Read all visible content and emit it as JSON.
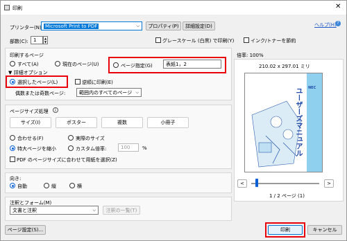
{
  "window": {
    "title": "印刷"
  },
  "printer": {
    "label": "プリンター(N):",
    "selected": "Microsoft Print to PDF",
    "properties_button": "プロパティ(P)",
    "advanced_button": "詳細設定(D)",
    "help_link": "ヘルプ(H)"
  },
  "copies": {
    "label": "部数(C):",
    "value": "1"
  },
  "options": {
    "grayscale": "グレースケール (白黒) で印刷(Y)",
    "save_ink": "インク/トナーを節約"
  },
  "pages": {
    "heading": "印刷するページ",
    "all": "すべて(A)",
    "current": "現在のページ(U)",
    "range": "ページ指定(G)",
    "range_value": "表紙1，2",
    "more_options": "詳細オプション",
    "selected_pages": "選択したページ(L)",
    "reverse": "逆順に印刷(E)",
    "odd_even_label": "偶数または奇数ページ:",
    "odd_even_value": "範囲内のすべてのページ"
  },
  "sizing": {
    "heading": "ページサイズ処理",
    "buttons": [
      "サイズ(I)",
      "ポスター",
      "複数",
      "小冊子"
    ],
    "fit": "合わせる(F)",
    "actual": "実際のサイズ",
    "shrink": "特大ページを縮小",
    "custom": "カスタム倍率:",
    "custom_value": "100",
    "percent": "%",
    "pdf_paper": "PDF のページサイズに合わせて用紙を選択(Z)"
  },
  "orientation": {
    "heading": "向き:",
    "auto": "自動",
    "portrait": "縦",
    "landscape": "横"
  },
  "comments": {
    "heading": "注釈とフォーム(M)",
    "value": "文書と注釈",
    "summary_button": "注釈の一覧(T)"
  },
  "preview": {
    "scale": "倍率: 100%",
    "dimensions": "210.02 x 297.01 ミリ",
    "nav_prev": "<",
    "nav_next": ">",
    "page_indicator": "1 / 2 ページ (1)",
    "cover_title": "ユーザーズマニュアル",
    "brand": "NEC",
    "slider_position": 0.08
  },
  "footer": {
    "page_setup": "ページ設定(S)...",
    "print": "印刷",
    "cancel": "キャンセル"
  },
  "colors": {
    "accent": "#0a5fd6",
    "highlight": "#e8000a",
    "cover_bg": "#8fd0ee",
    "cover_text": "#1f4aa8"
  }
}
